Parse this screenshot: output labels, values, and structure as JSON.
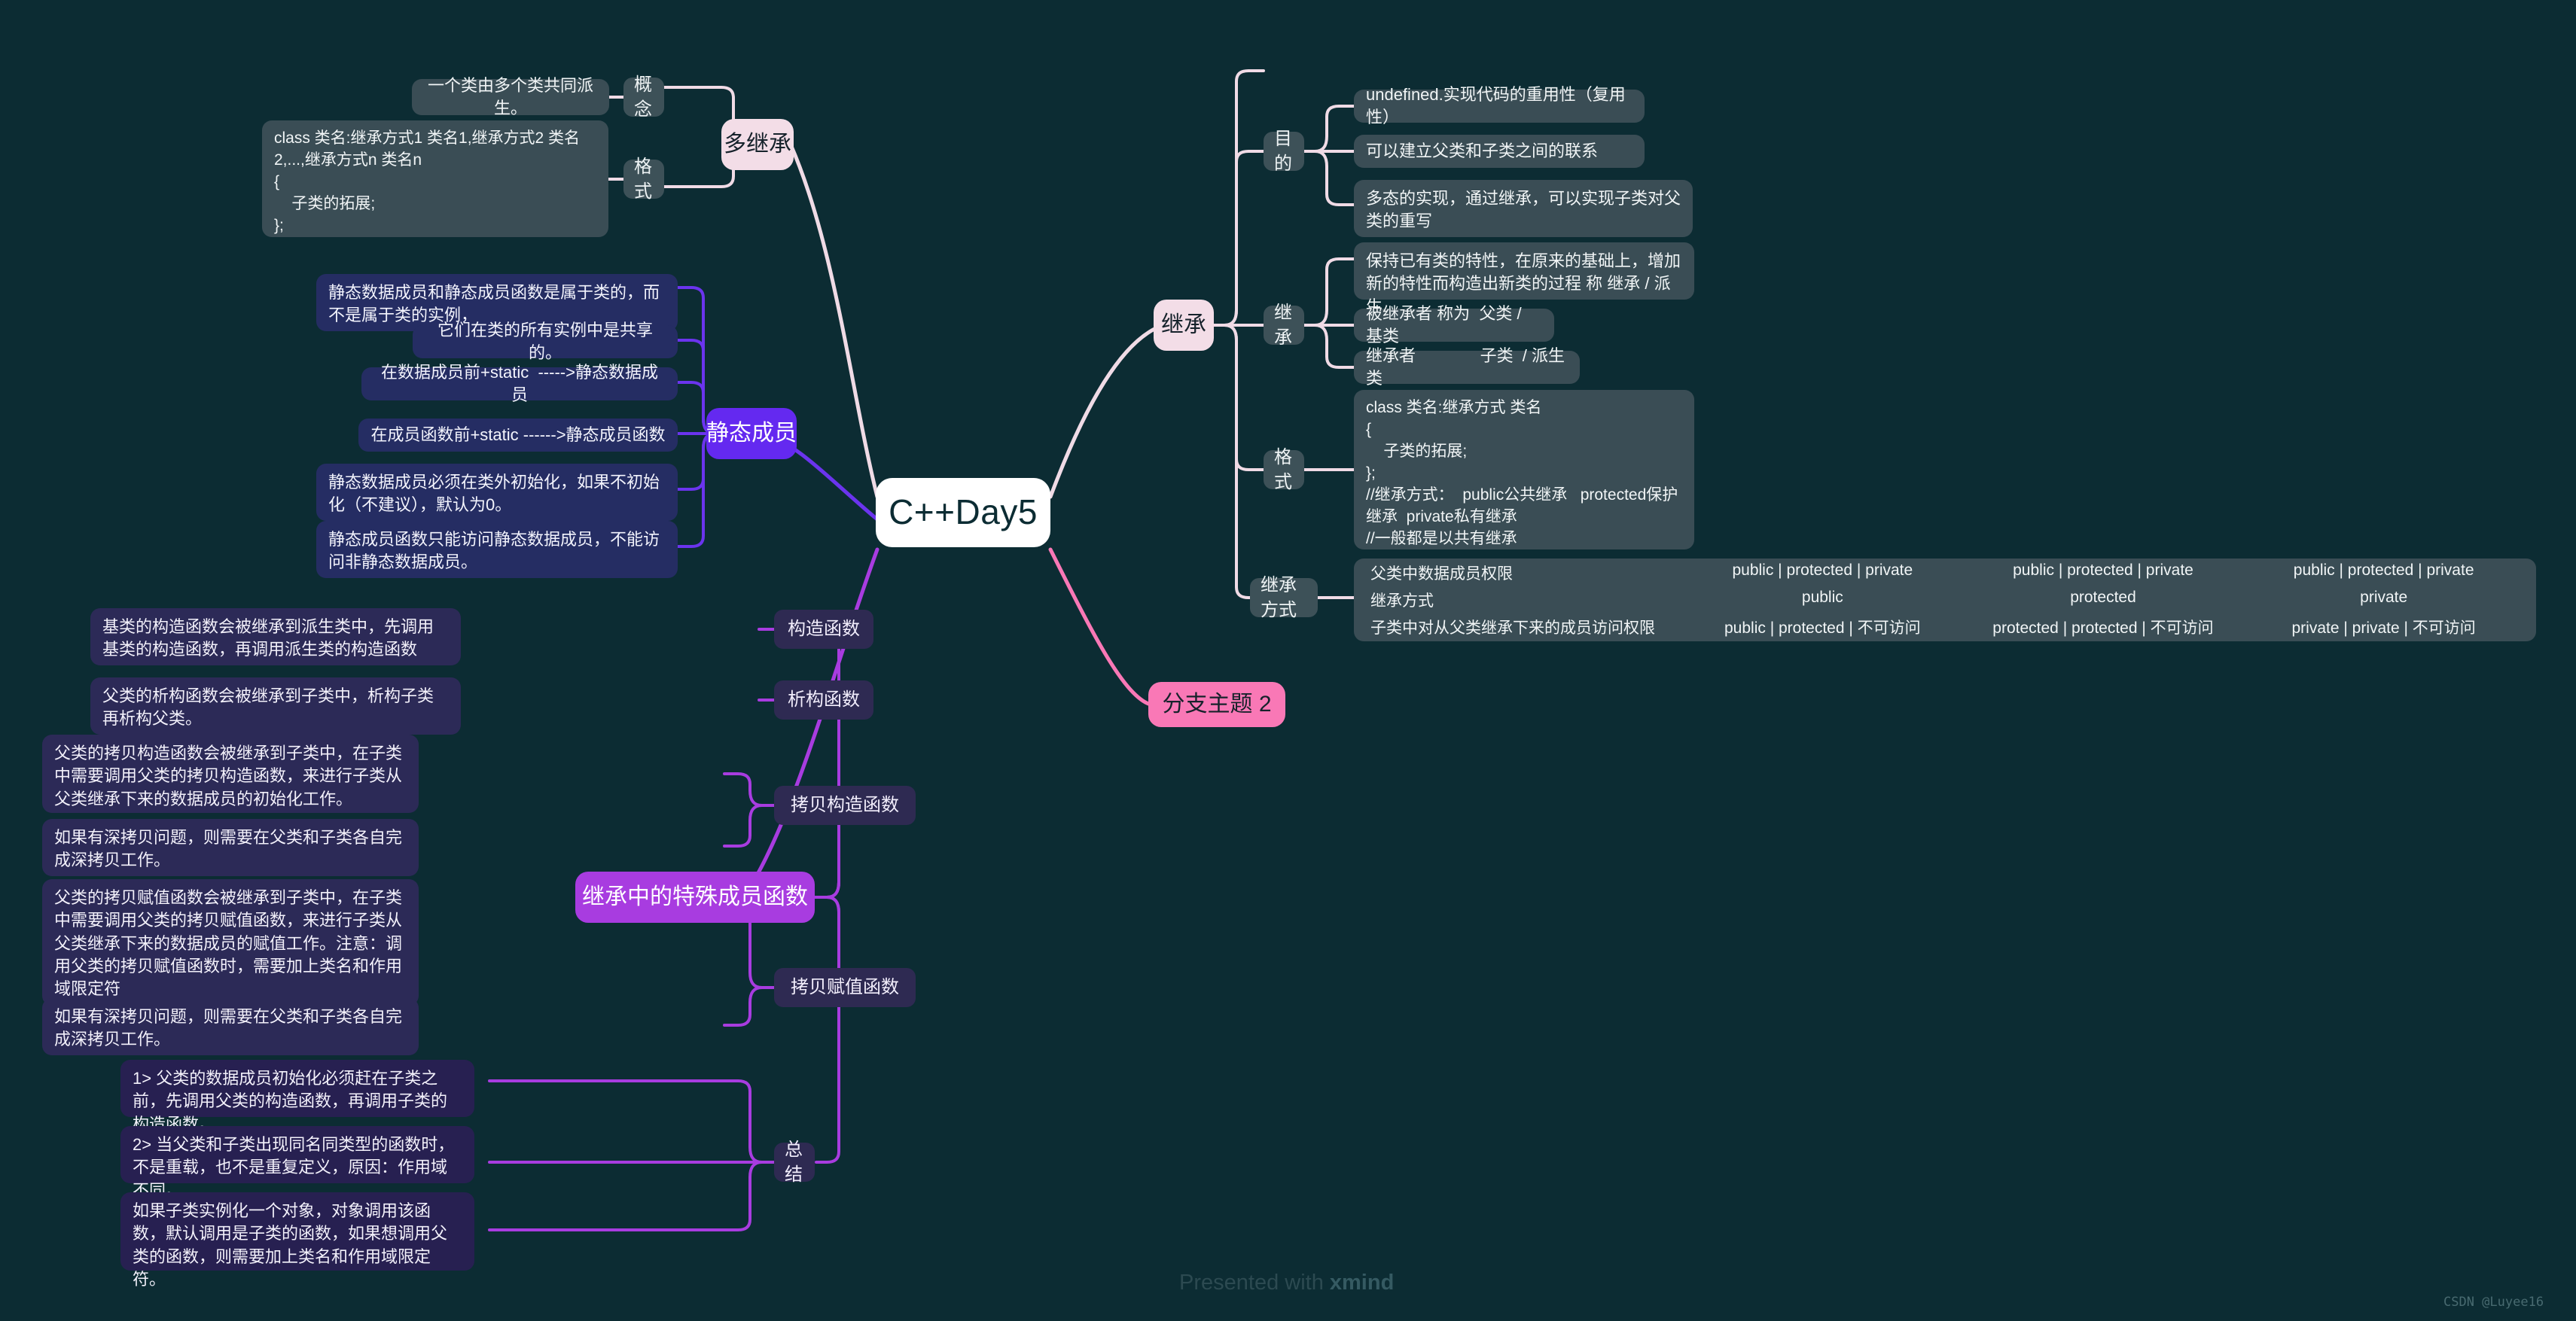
{
  "central": {
    "label": "C++Day5"
  },
  "watermark": {
    "prefix": "Presented with ",
    "brand": "xmind",
    "corner": "CSDN @Luyee16"
  },
  "branches": {
    "multi_inherit": {
      "label": "多继承",
      "concept_label": "概念",
      "concept_note": "一个类由多个类共同派生。",
      "format_label": "格式",
      "format_note": "class 类名:继承方式1 类名1,继承方式2 类名2,...,继承方式n 类名n\n{\n    子类的拓展;\n};"
    },
    "static_member": {
      "label": "静态成员",
      "notes": [
        "静态数据成员和静态成员函数是属于类的，而不是属于类的实例，",
        "它们在类的所有实例中是共享的。",
        "在数据成员前+static  ----->静态数据成员",
        "在成员函数前+static ------>静态成员函数",
        "静态数据成员必须在类外初始化，如果不初始化（不建议），默认为0。",
        "静态成员函数只能访问静态数据成员，不能访问非静态数据成员。"
      ]
    },
    "inherit": {
      "label": "继承",
      "purpose_label": "目的",
      "purpose_notes": [
        "undefined.实现代码的重用性（复用性）",
        "可以建立父类和子类之间的联系",
        "多态的实现，通过继承，可以实现子类对父类的重写"
      ],
      "inherit_label": "继承",
      "inherit_notes": [
        "保持已有类的特性，在原来的基础上，增加新的特性而构造出新类的过程 称 继承 / 派生",
        "被继承者 称为  父类 / 基类",
        "继承者              子类  / 派生类"
      ],
      "format_label": "格式",
      "format_note": "class 类名:继承方式 类名\n{\n    子类的拓展;\n};\n//继承方式：  public公共继承   protected保护继承  private私有继承\n//一般都是以共有继承",
      "mode_label": "继承方式",
      "mode_table": {
        "rows": [
          {
            "head": "父类中数据成员权限",
            "values": [
              "public | protected | private",
              "public | protected | private",
              "public | protected | private"
            ]
          },
          {
            "head": "继承方式",
            "values": [
              "public",
              "protected",
              "private"
            ]
          },
          {
            "head": "子类中对从父类继承下来的成员访问权限",
            "values": [
              "public | protected | 不可访问",
              "protected | protected | 不可访问",
              "private | private  | 不可访问"
            ]
          }
        ]
      }
    },
    "branch_topic_2": {
      "label": "分支主题 2"
    },
    "special_members": {
      "label": "继承中的特殊成员函数",
      "groups": [
        {
          "label": "构造函数",
          "notes": [
            "基类的构造函数会被继承到派生类中，先调用基类的构造函数，再调用派生类的构造函数"
          ]
        },
        {
          "label": "析构函数",
          "notes": [
            "父类的析构函数会被继承到子类中，析构子类再析构父类。"
          ]
        },
        {
          "label": "拷贝构造函数",
          "notes": [
            "父类的拷贝构造函数会被继承到子类中，在子类中需要调用父类的拷贝构造函数，来进行子类从父类继承下来的数据成员的初始化工作。",
            "如果有深拷贝问题，则需要在父类和子类各自完成深拷贝工作。"
          ]
        },
        {
          "label": "拷贝赋值函数",
          "notes": [
            "父类的拷贝赋值函数会被继承到子类中，在子类中需要调用父类的拷贝赋值函数，来进行子类从父类继承下来的数据成员的赋值工作。注意：调用父类的拷贝赋值函数时，需要加上类名和作用域限定符",
            "如果有深拷贝问题，则需要在父类和子类各自完成深拷贝工作。"
          ]
        },
        {
          "label": "总结",
          "notes": [
            "1> 父类的数据成员初始化必须赶在子类之前，先调用父类的构造函数，再调用子类的构造函数。",
            "2> 当父类和子类出现同名同类型的函数时，不是重载，也不是重复定义，原因：作用域不同。",
            "如果子类实例化一个对象，对象调用该函数，默认调用是子类的函数，如果想调用父类的函数，则需要加上类名和作用域限定符。"
          ]
        }
      ]
    }
  },
  "colors": {
    "background": "#0c2c33",
    "central_fill": "#ffffff",
    "pink_branch": "#f3dde7",
    "violet_branch": "#6429f0",
    "purple_branch": "#a83ce0",
    "hotpink_branch": "#f978b6",
    "slate_node": "#3a4d55",
    "navy_node": "#2c2a57",
    "link_pink": "#f0dbe6",
    "link_violet": "#6b34ee",
    "link_purple": "#a83ce0"
  }
}
